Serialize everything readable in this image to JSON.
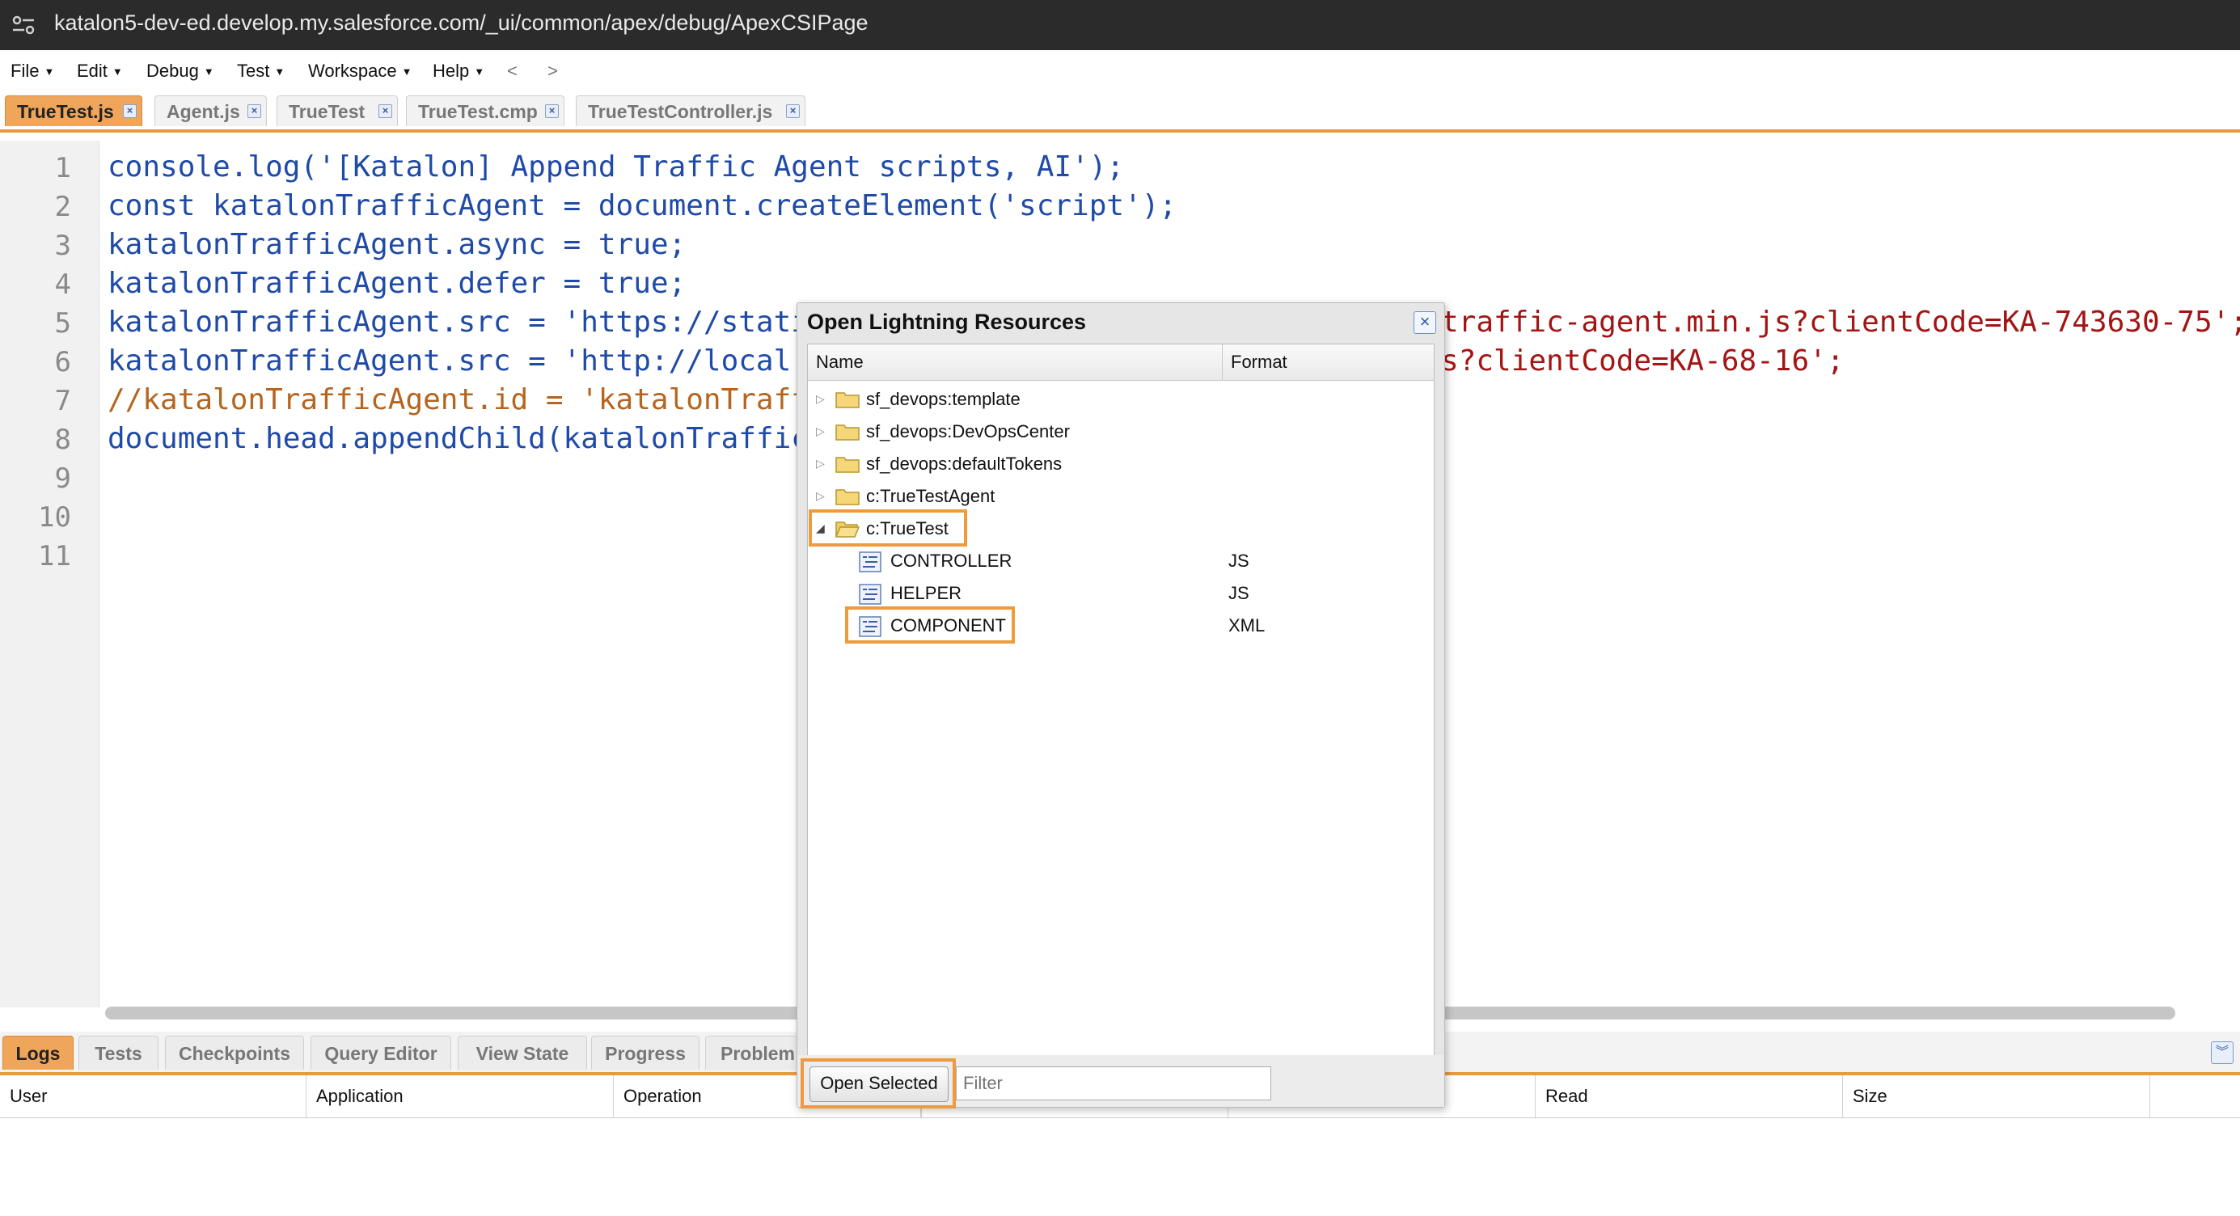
{
  "browser": {
    "url": "katalon5-dev-ed.develop.my.salesforce.com/_ui/common/apex/debug/ApexCSIPage"
  },
  "menu": {
    "items": [
      "File",
      "Edit",
      "Debug",
      "Test",
      "Workspace",
      "Help"
    ],
    "back": "<",
    "forward": ">"
  },
  "editor_tabs": [
    {
      "label": "TrueTest.js",
      "active": true
    },
    {
      "label": "Agent.js",
      "active": false
    },
    {
      "label": "TrueTest",
      "active": false
    },
    {
      "label": "TrueTest.cmp",
      "active": false
    },
    {
      "label": "TrueTestController.js",
      "active": false
    }
  ],
  "code": {
    "line_numbers": [
      "1",
      "2",
      "3",
      "4",
      "5",
      "6",
      "7",
      "8",
      "9",
      "10",
      "11"
    ],
    "lines": [
      "console.log('[Katalon] Append Traffic Agent scripts, AI');",
      "const katalonTrafficAgent = document.createElement('script');",
      "katalonTrafficAgent.async = true;",
      "katalonTrafficAgent.defer = true;",
      "katalonTrafficAgent.src = 'https://stati",
      "katalonTrafficAgent.src = 'http://local",
      "//katalonTrafficAgent.id = 'katalonTraff",
      "document.head.appendChild(katalonTraffic",
      "",
      "",
      ""
    ],
    "line5_tail": "traffic-agent.min.js?clientCode=KA-743630-75';",
    "line6_tail": "s?clientCode=KA-68-16';"
  },
  "dialog": {
    "title": "Open Lightning Resources",
    "columns": [
      "Name",
      "Format"
    ],
    "rows": [
      {
        "name": "sf_devops:template",
        "format": "",
        "type": "folder",
        "expanded": false
      },
      {
        "name": "sf_devops:DevOpsCenter",
        "format": "",
        "type": "folder",
        "expanded": false
      },
      {
        "name": "sf_devops:defaultTokens",
        "format": "",
        "type": "folder",
        "expanded": false
      },
      {
        "name": "c:TrueTestAgent",
        "format": "",
        "type": "folder",
        "expanded": false
      },
      {
        "name": "c:TrueTest",
        "format": "",
        "type": "folder",
        "expanded": true
      },
      {
        "name": "CONTROLLER",
        "format": "JS",
        "type": "file"
      },
      {
        "name": "HELPER",
        "format": "JS",
        "type": "file"
      },
      {
        "name": "COMPONENT",
        "format": "XML",
        "type": "file"
      }
    ],
    "open_button": "Open Selected",
    "filter_placeholder": "Filter"
  },
  "bottom_tabs": [
    {
      "label": "Logs",
      "active": true
    },
    {
      "label": "Tests",
      "active": false
    },
    {
      "label": "Checkpoints",
      "active": false
    },
    {
      "label": "Query Editor",
      "active": false
    },
    {
      "label": "View State",
      "active": false
    },
    {
      "label": "Progress",
      "active": false
    },
    {
      "label": "Problem",
      "active": false
    }
  ],
  "log_columns": [
    "User",
    "Application",
    "Operation",
    "Read",
    "Size"
  ],
  "colors": {
    "accent": "#f0a65a",
    "highlight": "#ef9a3c",
    "urlbar": "#2b2b2b"
  }
}
